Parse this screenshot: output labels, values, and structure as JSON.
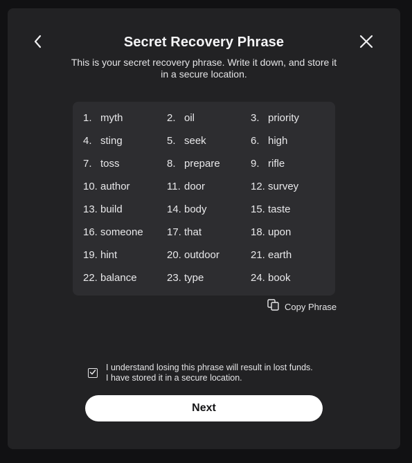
{
  "header": {
    "title": "Secret Recovery Phrase",
    "subtitle": "This is your secret recovery phrase. Write it down, and store it in a secure location.",
    "back_icon": "chevron-left-icon",
    "close_icon": "close-icon"
  },
  "phrase": {
    "words": [
      {
        "num": "1.",
        "word": "myth"
      },
      {
        "num": "2.",
        "word": "oil"
      },
      {
        "num": "3.",
        "word": "priority"
      },
      {
        "num": "4.",
        "word": "sting"
      },
      {
        "num": "5.",
        "word": "seek"
      },
      {
        "num": "6.",
        "word": "high"
      },
      {
        "num": "7.",
        "word": "toss"
      },
      {
        "num": "8.",
        "word": "prepare"
      },
      {
        "num": "9.",
        "word": "rifle"
      },
      {
        "num": "10.",
        "word": "author"
      },
      {
        "num": "11.",
        "word": "door"
      },
      {
        "num": "12.",
        "word": "survey"
      },
      {
        "num": "13.",
        "word": "build"
      },
      {
        "num": "14.",
        "word": "body"
      },
      {
        "num": "15.",
        "word": "taste"
      },
      {
        "num": "16.",
        "word": "someone"
      },
      {
        "num": "17.",
        "word": "that"
      },
      {
        "num": "18.",
        "word": "upon"
      },
      {
        "num": "19.",
        "word": "hint"
      },
      {
        "num": "20.",
        "word": "outdoor"
      },
      {
        "num": "21.",
        "word": "earth"
      },
      {
        "num": "22.",
        "word": "balance"
      },
      {
        "num": "23.",
        "word": "type"
      },
      {
        "num": "24.",
        "word": "book"
      }
    ]
  },
  "copy": {
    "label": "Copy Phrase",
    "icon": "copy-icon"
  },
  "consent": {
    "checked": true,
    "line1": "I understand losing this phrase will result in lost funds.",
    "line2": "I have stored it in a secure location."
  },
  "actions": {
    "next_label": "Next"
  },
  "colors": {
    "background": "#111113",
    "panel": "#222224",
    "phrase_box": "#2d2d30",
    "text": "#e8e8ea",
    "button": "#ffffff"
  }
}
